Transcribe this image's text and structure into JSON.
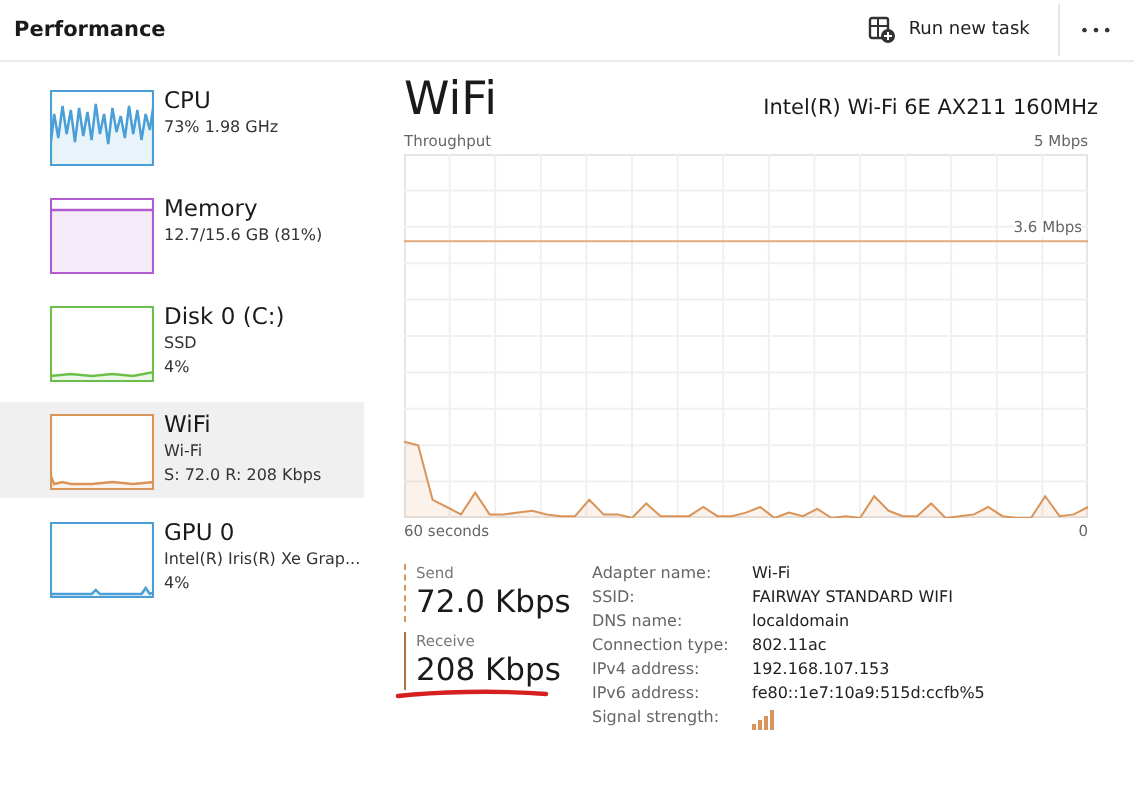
{
  "header": {
    "title": "Performance",
    "run_task": "Run new task",
    "more": "•••"
  },
  "sidebar": {
    "items": [
      {
        "kind": "cpu",
        "color": "#4a9fd6",
        "name": "CPU",
        "lines": [
          "73%  1.98 GHz"
        ],
        "selected": false
      },
      {
        "kind": "memory",
        "color": "#b05bd0",
        "name": "Memory",
        "lines": [
          "12.7/15.6 GB (81%)"
        ],
        "selected": false
      },
      {
        "kind": "disk",
        "color": "#6cbf4a",
        "name": "Disk 0 (C:)",
        "lines": [
          "SSD",
          "4%"
        ],
        "selected": false
      },
      {
        "kind": "wifi",
        "color": "#d9945a",
        "name": "WiFi",
        "lines": [
          "Wi-Fi",
          "S: 72.0 R: 208 Kbps"
        ],
        "selected": true
      },
      {
        "kind": "gpu",
        "color": "#4a9fd6",
        "name": "GPU 0",
        "lines": [
          "Intel(R) Iris(R) Xe Grap...",
          "4%"
        ],
        "selected": false
      }
    ]
  },
  "main": {
    "title": "WiFi",
    "adapter": "Intel(R) Wi-Fi 6E AX211 160MHz",
    "graph": {
      "label": "Throughput",
      "max": "5 Mbps",
      "marker": "3.6 Mbps",
      "x_start": "60 seconds",
      "x_end": "0"
    },
    "send": {
      "label": "Send",
      "value": "72.0 Kbps"
    },
    "receive": {
      "label": "Receive",
      "value": "208 Kbps"
    },
    "details": [
      {
        "label": "Adapter name:",
        "value": "Wi-Fi"
      },
      {
        "label": "SSID:",
        "value": "FAIRWAY STANDARD WIFI"
      },
      {
        "label": "DNS name:",
        "value": "localdomain"
      },
      {
        "label": "Connection type:",
        "value": "802.11ac"
      },
      {
        "label": "IPv4 address:",
        "value": "192.168.107.153"
      },
      {
        "label": "IPv6 address:",
        "value": "fe80::1e7:10a9:515d:ccfb%5"
      },
      {
        "label": "Signal strength:",
        "kind": "signal"
      }
    ]
  }
}
